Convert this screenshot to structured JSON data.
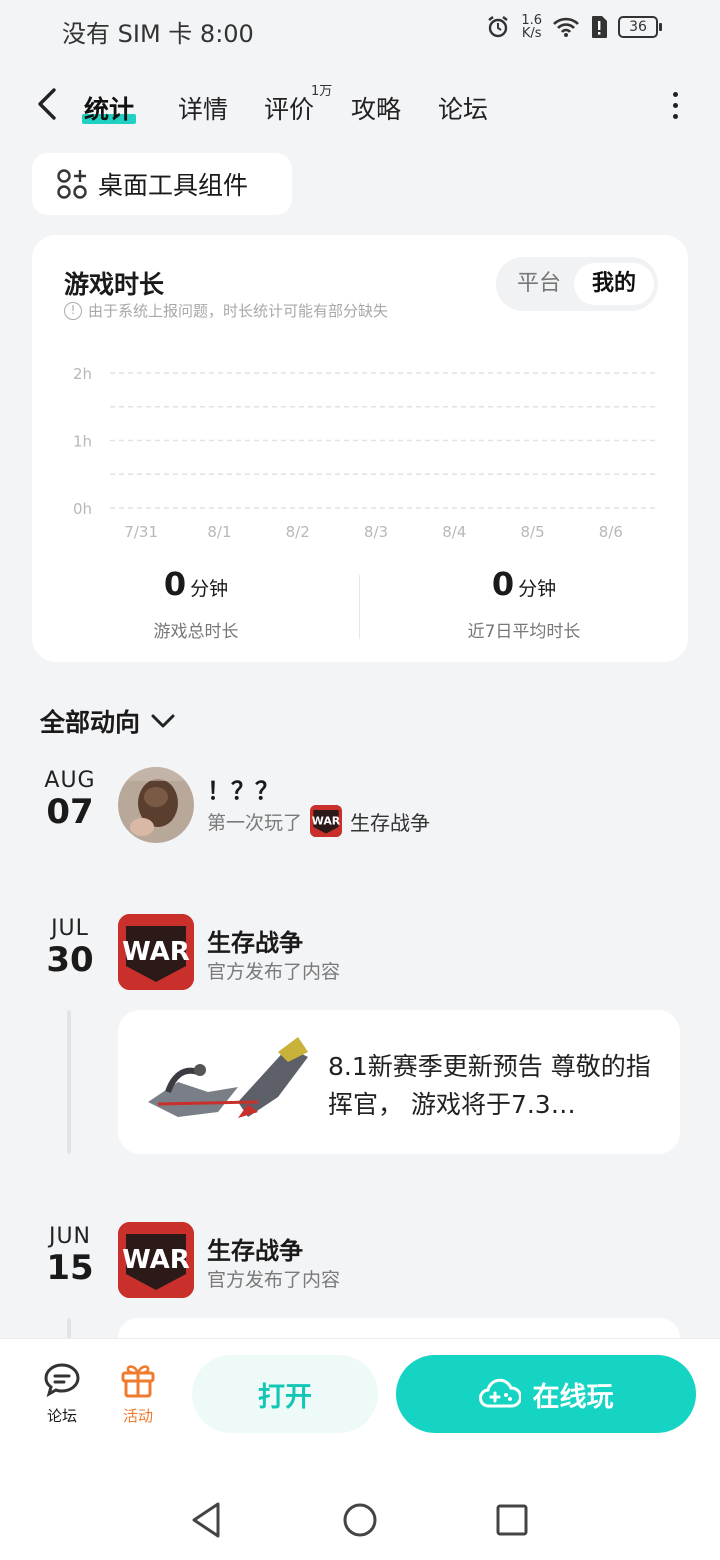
{
  "status_bar": {
    "carrier": "没有 SIM 卡",
    "time": "8:00",
    "speed_value": "1.6",
    "speed_unit": "K/s",
    "battery": "36"
  },
  "nav": {
    "tabs": [
      {
        "label": "统计",
        "active": true
      },
      {
        "label": "详情"
      },
      {
        "label": "评价",
        "badge": "1万"
      },
      {
        "label": "攻略"
      },
      {
        "label": "论坛"
      }
    ]
  },
  "widget_button": {
    "label": "桌面工具组件"
  },
  "stats": {
    "title": "游戏时长",
    "note": "由于系统上报问题，时长统计可能有部分缺失",
    "segment": {
      "left": "平台",
      "right": "我的",
      "selected": "我的"
    },
    "total": {
      "value": "0",
      "unit": "分钟",
      "caption": "游戏总时长"
    },
    "average": {
      "value": "0",
      "unit": "分钟",
      "caption": "近7日平均时长"
    }
  },
  "chart_data": {
    "type": "bar",
    "categories": [
      "7/31",
      "8/1",
      "8/2",
      "8/3",
      "8/4",
      "8/5",
      "8/6"
    ],
    "values": [
      0,
      0,
      0,
      0,
      0,
      0,
      0
    ],
    "y_ticks": [
      "2h",
      "1h",
      "0h"
    ],
    "ylim": [
      0,
      2
    ],
    "grid": true
  },
  "feed": {
    "section_title": "全部动向",
    "items": [
      {
        "month": "AUG",
        "day": "07",
        "title": "！？？",
        "sub_prefix": "第一次玩了",
        "game": "生存战争"
      },
      {
        "month": "JUL",
        "day": "30",
        "title": "生存战争",
        "sub": "官方发布了内容",
        "post_text": "8.1新赛季更新预告 尊敬的指挥官， 游戏将于7.3…"
      },
      {
        "month": "JUN",
        "day": "15",
        "title": "生存战争",
        "sub": "官方发布了内容"
      }
    ]
  },
  "bottom": {
    "forum_label": "论坛",
    "activity_label": "活动",
    "open_label": "打开",
    "play_label": "在线玩",
    "accent": "#16d4c3",
    "activity_color": "#f07a2e"
  },
  "app_icon_text": "WAR"
}
